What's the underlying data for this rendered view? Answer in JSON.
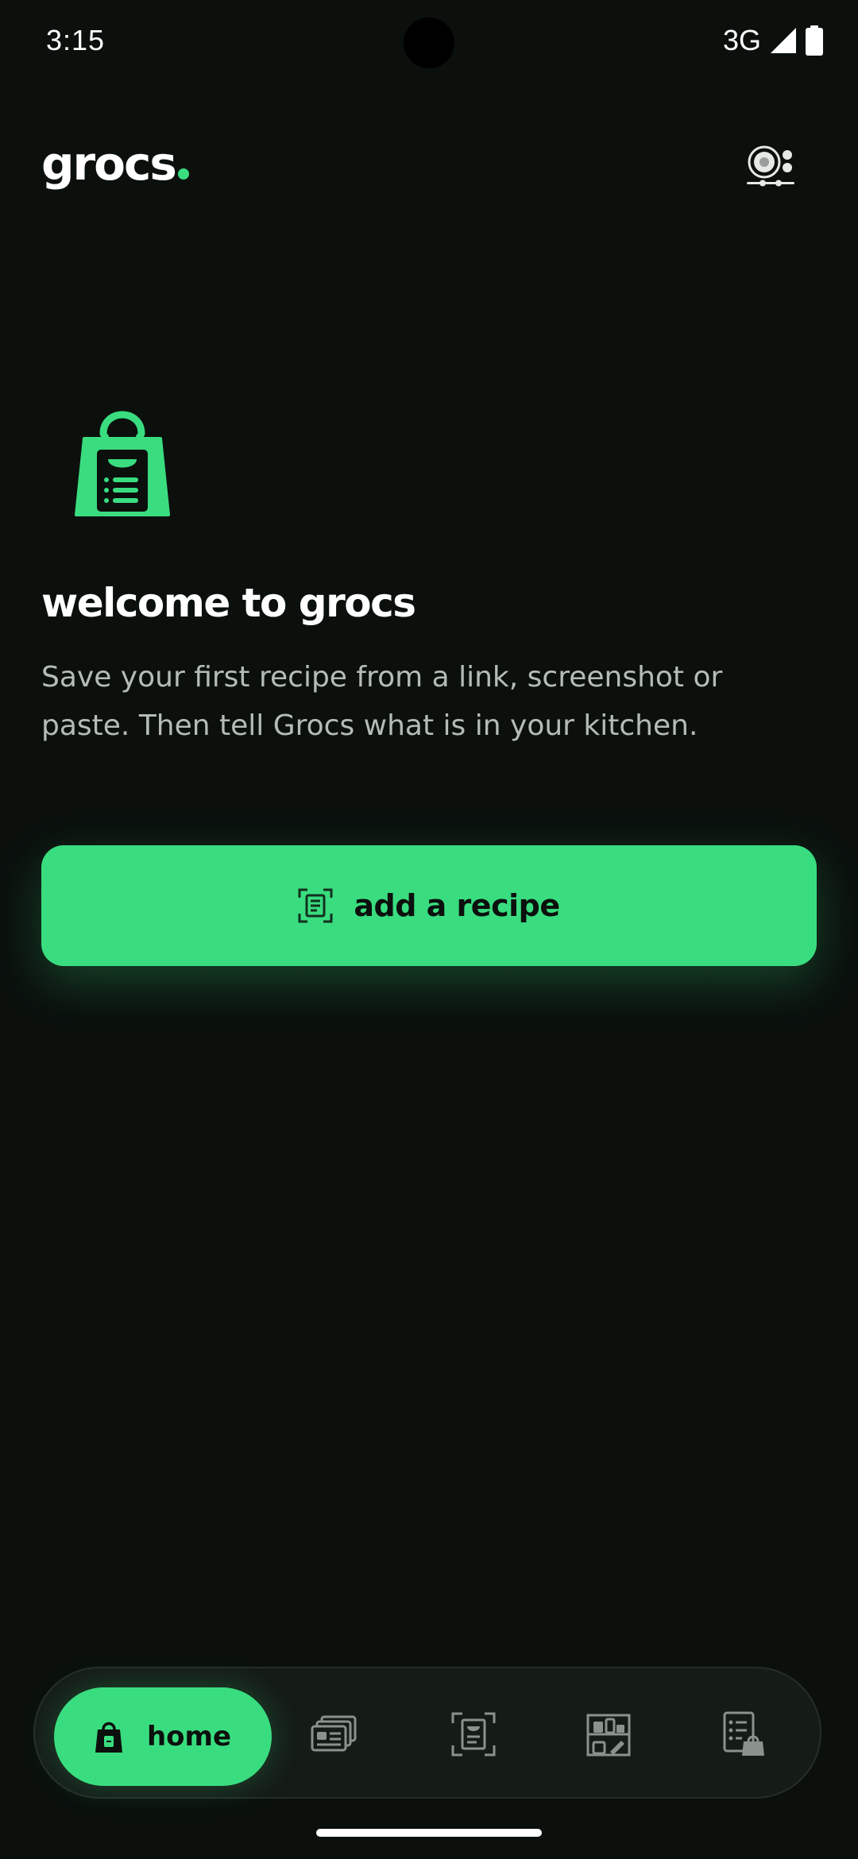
{
  "status_bar": {
    "time": "3:15",
    "network": "3G"
  },
  "header": {
    "brand": "grocs",
    "settings_icon": "preferences-icon"
  },
  "hero": {
    "icon": "grocery-bag-icon",
    "title": "welcome to grocs",
    "body": "Save your first recipe from a link, screenshot or paste. Then tell Grocs what is in your kitchen."
  },
  "cta": {
    "label": "add a recipe",
    "icon": "scan-recipe-icon"
  },
  "nav": {
    "items": [
      {
        "label": "home",
        "icon": "grocery-bag-icon",
        "active": true
      },
      {
        "label": "",
        "icon": "recipes-stack-icon",
        "active": false
      },
      {
        "label": "",
        "icon": "scan-recipe-icon",
        "active": false
      },
      {
        "label": "",
        "icon": "pantry-shelf-icon",
        "active": false
      },
      {
        "label": "",
        "icon": "shopping-list-icon",
        "active": false
      }
    ]
  },
  "colors": {
    "background": "#0b100d",
    "accent": "#39dd7f",
    "body_text": "#b5bcb7",
    "nav_bg": "#151b17",
    "icon_muted": "#8b928d"
  }
}
